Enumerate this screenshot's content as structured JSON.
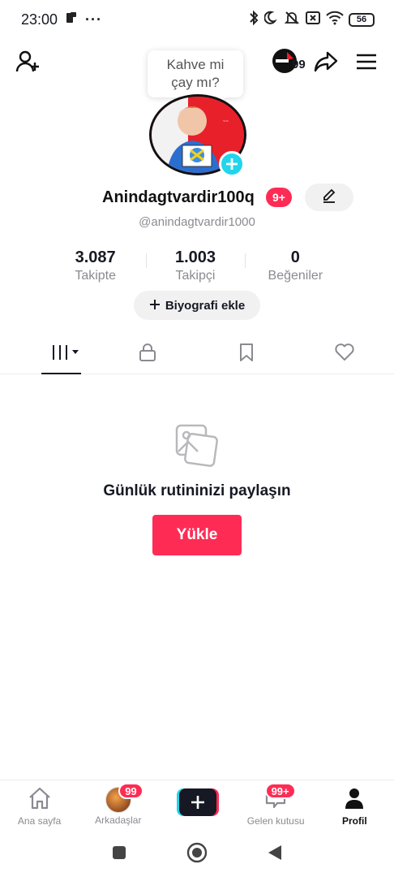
{
  "status_bar": {
    "time": "23:00",
    "overflow": "···",
    "battery": "56"
  },
  "header": {
    "tooltip_line1": "Kahve mi",
    "tooltip_line2": "çay mı?",
    "streak_count": "99"
  },
  "profile": {
    "username": "Anindagtvardir100q",
    "username_badge": "9+",
    "handle": "@anindagtvardir1000",
    "stats": [
      {
        "value": "3.087",
        "label": "Takipte"
      },
      {
        "value": "1.003",
        "label": "Takipçi"
      },
      {
        "value": "0",
        "label": "Beğeniler"
      }
    ],
    "bio_button_label": "Biyografi ekle"
  },
  "empty_state": {
    "title": "Günlük rutininizi paylaşın",
    "button_label": "Yükle"
  },
  "bottom_nav": {
    "items": [
      {
        "label": "Ana sayfa",
        "icon": "home-icon"
      },
      {
        "label": "Arkadaşlar",
        "icon": "friends-avatar",
        "badge": "99"
      },
      {
        "label": "",
        "icon": "create-icon"
      },
      {
        "label": "Gelen kutusu",
        "icon": "inbox-icon",
        "badge": "99+"
      },
      {
        "label": "Profil",
        "icon": "profile-icon"
      }
    ]
  },
  "colors": {
    "accent": "#fe2c55",
    "cyan": "#20d5ec",
    "text": "#161823",
    "muted": "#8a8b91"
  }
}
